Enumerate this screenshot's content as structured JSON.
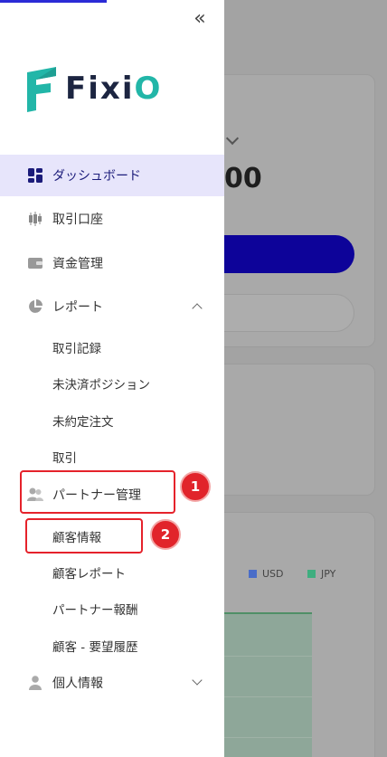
{
  "brand": {
    "logo_text_prefix": "Fix",
    "logo_text_i": "i",
    "logo_text_o": "O",
    "logo_color_dark": "#1c2541",
    "logo_color_accent": "#22b6a8"
  },
  "sidebar": {
    "collapse_icon": "double-chevron-left-icon",
    "items": [
      {
        "label": "ダッシュボード",
        "icon": "dashboard-icon",
        "active": true
      },
      {
        "label": "取引口座",
        "icon": "candlestick-icon"
      },
      {
        "label": "資金管理",
        "icon": "wallet-icon"
      },
      {
        "label": "レポート",
        "icon": "pie-chart-icon",
        "expanded": true,
        "children": [
          "取引記録",
          "未決済ポジション",
          "未約定注文",
          "取引"
        ]
      },
      {
        "label": "パートナー管理",
        "icon": "users-icon",
        "expanded": true,
        "children": [
          "顧客情報",
          "顧客レポート",
          "パートナー報酬",
          "顧客 - 要望履歴"
        ]
      },
      {
        "label": "個人情報",
        "icon": "user-icon",
        "expanded": false
      }
    ]
  },
  "annotations": {
    "badge1": "1",
    "badge2": "2",
    "highlight_color": "#e5222b"
  },
  "background": {
    "balance_text": "00",
    "legend": [
      "USD",
      "JPY"
    ],
    "legend_colors": [
      "#4a6dc8",
      "#3fae7f"
    ],
    "primary_button_color": "#0d0399"
  }
}
